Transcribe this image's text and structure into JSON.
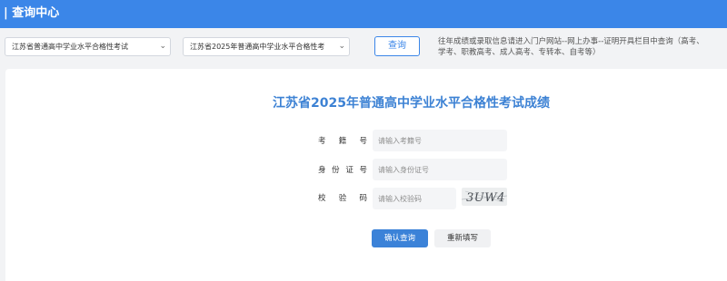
{
  "header": {
    "title": "| 查询中心",
    "background_color": "#3b86e8"
  },
  "filters": {
    "exam_category": {
      "selected": "江苏省普通高中学业水平合格性考试",
      "icon": "chevron-down-icon"
    },
    "exam_session": {
      "selected": "江苏省2025年普通高中学业水平合格性考",
      "icon": "chevron-down-icon"
    }
  },
  "query_button_label": "查询",
  "notice": {
    "line1": "往年成绩或录取信息请进入门户网站--网上办事--证明开具栏目中查询（高考、",
    "line2": "学考、职教高考、成人高考、专转本、自考等）"
  },
  "form": {
    "title": "江苏省2025年普通高中学业水平合格性考试成绩",
    "title_color": "#3d82d4",
    "fields": [
      {
        "label_chars": [
          "考",
          "籍",
          "号"
        ],
        "placeholder": "请输入考籍号",
        "value": ""
      },
      {
        "label_chars": [
          "身",
          "份",
          "证",
          "号"
        ],
        "placeholder": "请输入身份证号",
        "value": ""
      },
      {
        "label_chars": [
          "校",
          "验",
          "码"
        ],
        "placeholder": "请输入校验码",
        "value": ""
      }
    ],
    "captcha": {
      "text": "3UW4",
      "icon": "captcha-image"
    },
    "confirm_label": "确认查询",
    "reset_label": "重新填写",
    "primary_color": "#3b82d8"
  }
}
